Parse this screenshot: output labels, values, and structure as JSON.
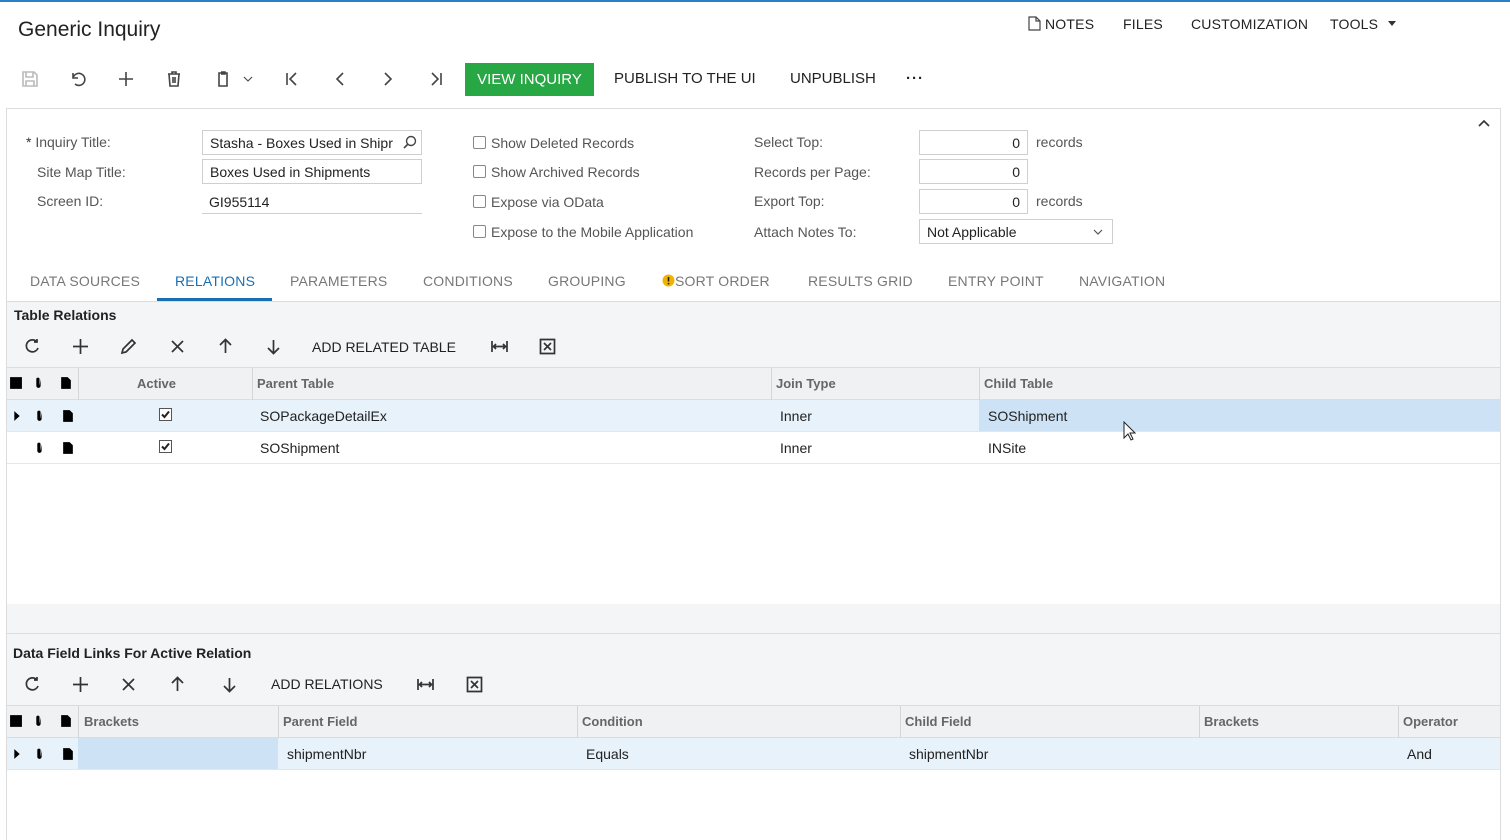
{
  "header": {
    "title": "Generic Inquiry",
    "links": {
      "notes": "NOTES",
      "files": "FILES",
      "customization": "CUSTOMIZATION",
      "tools": "TOOLS"
    }
  },
  "toolbar": {
    "view_inquiry": "VIEW INQUIRY",
    "publish": "PUBLISH TO THE UI",
    "unpublish": "UNPUBLISH",
    "more": "···"
  },
  "form": {
    "inquiry_title_label": "Inquiry Title:",
    "inquiry_title_required": "*",
    "inquiry_title_value": "Stasha - Boxes Used in Shipr",
    "site_map_title_label": "Site Map Title:",
    "site_map_title_value": "Boxes Used in Shipments",
    "screen_id_label": "Screen ID:",
    "screen_id_value": "GI955114",
    "show_deleted": "Show Deleted Records",
    "show_archived": "Show Archived Records",
    "expose_odata": "Expose via OData",
    "expose_mobile": "Expose to the Mobile Application",
    "select_top_label": "Select Top:",
    "select_top_value": "0",
    "select_top_unit": "records",
    "records_per_page_label": "Records per Page:",
    "records_per_page_value": "0",
    "export_top_label": "Export Top:",
    "export_top_value": "0",
    "export_top_unit": "records",
    "attach_notes_label": "Attach Notes To:",
    "attach_notes_value": "Not Applicable"
  },
  "tabs": [
    {
      "label": "DATA SOURCES"
    },
    {
      "label": "RELATIONS"
    },
    {
      "label": "PARAMETERS"
    },
    {
      "label": "CONDITIONS"
    },
    {
      "label": "GROUPING"
    },
    {
      "label": "SORT ORDER"
    },
    {
      "label": "RESULTS GRID"
    },
    {
      "label": "ENTRY POINT"
    },
    {
      "label": "NAVIGATION"
    }
  ],
  "table_relations": {
    "title": "Table Relations",
    "add_button": "ADD RELATED TABLE",
    "columns": {
      "active": "Active",
      "parent": "Parent Table",
      "join": "Join Type",
      "child": "Child Table"
    },
    "rows": [
      {
        "active": true,
        "parent": "SOPackageDetailEx",
        "join": "Inner",
        "child": "SOShipment"
      },
      {
        "active": true,
        "parent": "SOShipment",
        "join": "Inner",
        "child": "INSite"
      }
    ]
  },
  "data_links": {
    "title": "Data Field Links For Active Relation",
    "add_button": "ADD RELATIONS",
    "columns": {
      "brackets1": "Brackets",
      "parent_field": "Parent Field",
      "condition": "Condition",
      "child_field": "Child Field",
      "brackets2": "Brackets",
      "operator": "Operator"
    },
    "rows": [
      {
        "brackets1": "",
        "parent_field": "shipmentNbr",
        "condition": "Equals",
        "child_field": "shipmentNbr",
        "brackets2": "",
        "operator": "And"
      }
    ]
  },
  "colors": {
    "accent": "#1a6fb3",
    "primary_button": "#28a745",
    "selection": "#cde3f5",
    "warning": "#f0b400"
  }
}
